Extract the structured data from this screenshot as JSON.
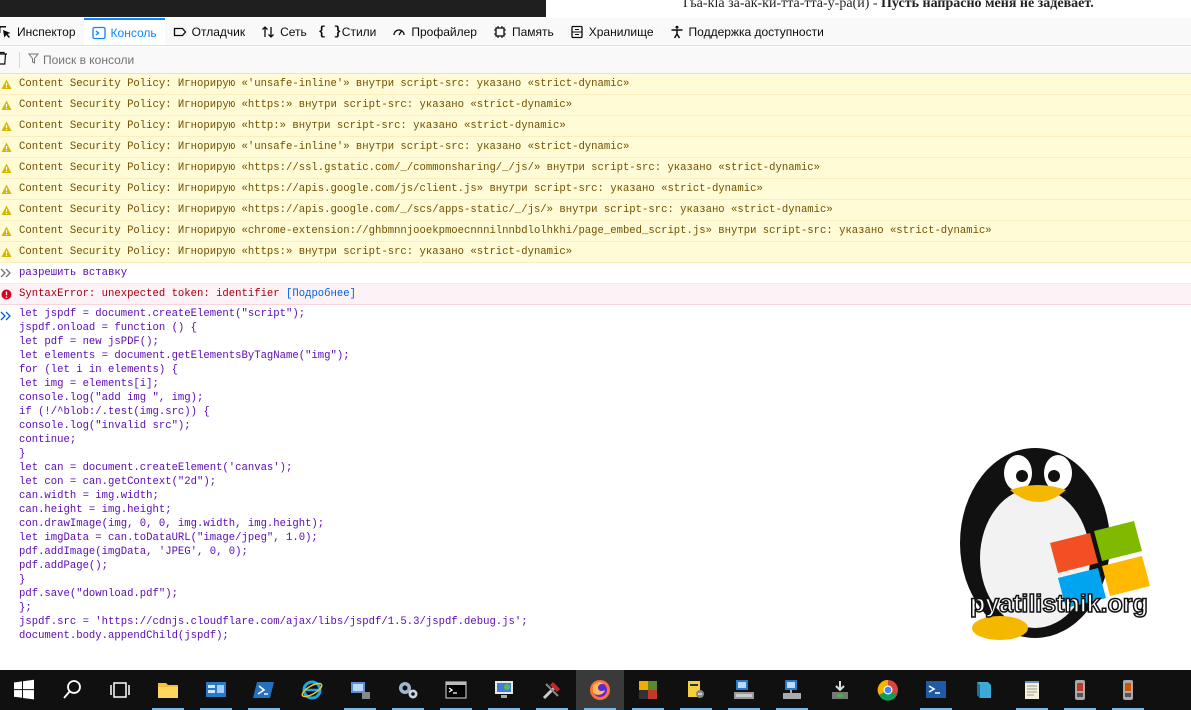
{
  "page_header_text": {
    "normal": "Гьа-kla за-ак-ки-тта-тта-у-ра(и) - ",
    "bold": "Пусть напрасно меня не задевает."
  },
  "toolbar": {
    "tabs": [
      {
        "label": "Инспектор",
        "icon": "inspector-icon"
      },
      {
        "label": "Консоль",
        "icon": "console-icon",
        "active": true
      },
      {
        "label": "Отладчик",
        "icon": "debugger-icon"
      },
      {
        "label": "Сеть",
        "icon": "network-icon"
      },
      {
        "label": "Стили",
        "icon": "style-editor-icon"
      },
      {
        "label": "Профайлер",
        "icon": "profiler-icon"
      },
      {
        "label": "Память",
        "icon": "memory-icon"
      },
      {
        "label": "Хранилище",
        "icon": "storage-icon"
      },
      {
        "label": "Поддержка доступности",
        "icon": "accessibility-icon"
      }
    ],
    "accent_color": "#0a84ff"
  },
  "filter": {
    "placeholder": "Поиск в консоли"
  },
  "messages": [
    {
      "type": "warning",
      "text": "Content Security Policy: Игнорирую «'unsafe-inline'» внутри script-src: указано «strict-dynamic»"
    },
    {
      "type": "warning",
      "text": "Content Security Policy: Игнорирую «https:» внутри script-src: указано «strict-dynamic»"
    },
    {
      "type": "warning",
      "text": "Content Security Policy: Игнорирую «http:» внутри script-src: указано «strict-dynamic»"
    },
    {
      "type": "warning",
      "text": "Content Security Policy: Игнорирую «'unsafe-inline'» внутри script-src: указано «strict-dynamic»"
    },
    {
      "type": "warning",
      "text": "Content Security Policy: Игнорирую «https://ssl.gstatic.com/_/commonsharing/_/js/» внутри script-src: указано «strict-dynamic»"
    },
    {
      "type": "warning",
      "text": "Content Security Policy: Игнорирую «https://apis.google.com/js/client.js» внутри script-src: указано «strict-dynamic»"
    },
    {
      "type": "warning",
      "text": "Content Security Policy: Игнорирую «https://apis.google.com/_/scs/apps-static/_/js/» внутри script-src: указано «strict-dynamic»"
    },
    {
      "type": "warning",
      "text": "Content Security Policy: Игнорирую «chrome-extension://ghbmnnjooekpmoecnnnilnnbdlolhkhi/page_embed_script.js» внутри script-src: указано «strict-dynamic»"
    },
    {
      "type": "warning",
      "text": "Content Security Policy: Игнорирую «https:» внутри script-src: указано «strict-dynamic»"
    },
    {
      "type": "input",
      "text": "разрешить вставку"
    },
    {
      "type": "error",
      "text": "SyntaxError: unexpected token: identifier ",
      "link": "[Подробнее]"
    }
  ],
  "input_code": "let jspdf = document.createElement(\"script\");\njspdf.onload = function () {\nlet pdf = new jsPDF();\nlet elements = document.getElementsByTagName(\"img\");\nfor (let i in elements) {\nlet img = elements[i];\nconsole.log(\"add img \", img);\nif (!/^blob:/.test(img.src)) {\nconsole.log(\"invalid src\");\ncontinue;\n}\nlet can = document.createElement('canvas');\nlet con = can.getContext(\"2d\");\ncan.width = img.width;\ncan.height = img.height;\ncon.drawImage(img, 0, 0, img.width, img.height);\nlet imgData = can.toDataURL(\"image/jpeg\", 1.0);\npdf.addImage(imgData, 'JPEG', 0, 0);\npdf.addPage();\n}\npdf.save(\"download.pdf\");\n};\njspdf.src = 'https://cdnjs.cloudflare.com/ajax/libs/jspdf/1.5.3/jspdf.debug.js';\ndocument.body.appendChild(jspdf);",
  "watermark": {
    "text": "pyatilistnik.org"
  },
  "taskbar": {
    "items": [
      {
        "icon": "windows-start-icon"
      },
      {
        "icon": "search-icon"
      },
      {
        "icon": "task-view-icon"
      },
      {
        "icon": "file-explorer-icon"
      },
      {
        "icon": "server-manager-icon"
      },
      {
        "icon": "powershell-icon"
      },
      {
        "icon": "internet-explorer-icon"
      },
      {
        "icon": "network-computer-icon"
      },
      {
        "icon": "settings-gears-icon"
      },
      {
        "icon": "command-prompt-icon"
      },
      {
        "icon": "remote-desktop-icon"
      },
      {
        "icon": "tools-icon"
      },
      {
        "icon": "firefox-icon",
        "active": true
      },
      {
        "icon": "app-tiles-icon"
      },
      {
        "icon": "registry-icon"
      },
      {
        "icon": "computer-management-icon"
      },
      {
        "icon": "network-connections-icon"
      },
      {
        "icon": "install-package-icon"
      },
      {
        "icon": "chrome-icon"
      },
      {
        "icon": "powershell-ise-icon"
      },
      {
        "icon": "book-icon"
      },
      {
        "icon": "notepad-icon"
      },
      {
        "icon": "usb-device-icon"
      },
      {
        "icon": "usb-device-2-icon"
      }
    ]
  }
}
